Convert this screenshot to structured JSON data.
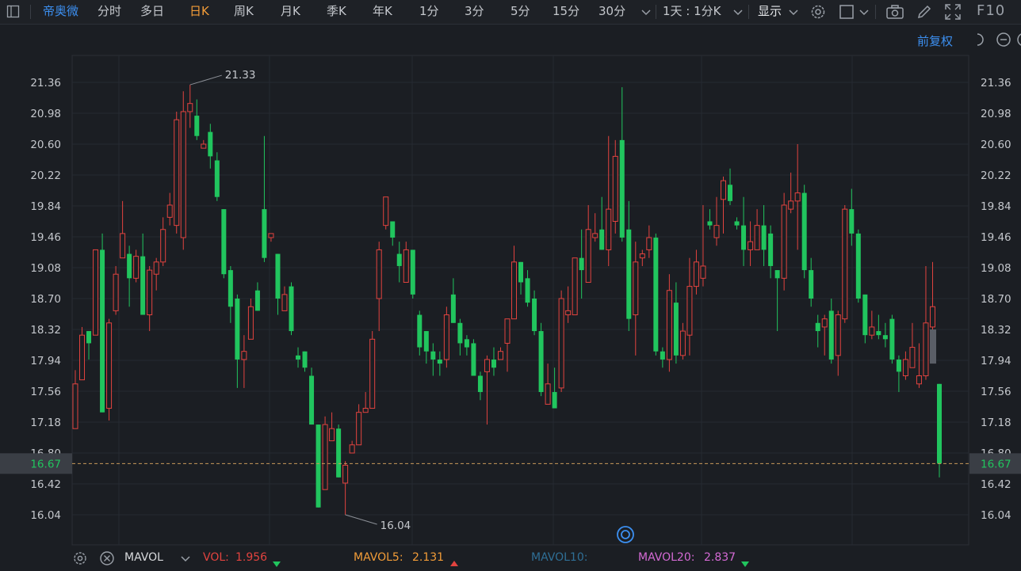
{
  "toolbar": {
    "stock_name": "帝奥微",
    "periods": [
      "分时",
      "多日",
      "日K",
      "周K",
      "月K",
      "季K",
      "年K",
      "1分",
      "3分",
      "5分",
      "15分",
      "30分"
    ],
    "active_period": "日K",
    "interval_select": "1天 : 1分K",
    "display_select": "显示",
    "f10": "F10"
  },
  "adjust_label": "前复权",
  "chart_data": {
    "type": "candlestick",
    "y_ticks": [
      "21.36",
      "20.98",
      "20.60",
      "20.22",
      "19.84",
      "19.46",
      "19.08",
      "18.70",
      "18.32",
      "17.94",
      "17.56",
      "17.18",
      "16.80",
      "16.42",
      "16.04"
    ],
    "current_price": "16.67",
    "high_label": "21.33",
    "low_label": "16.04",
    "up_color": "#e2433f",
    "down_color": "#21c55e",
    "candles": [
      [
        17.1,
        17.65,
        17.82,
        17.1
      ],
      [
        17.7,
        18.25,
        18.35,
        17.7
      ],
      [
        18.3,
        18.15,
        18.3,
        17.95
      ],
      [
        18.25,
        19.3,
        19.3,
        18.25
      ],
      [
        19.3,
        17.3,
        19.5,
        17.3
      ],
      [
        17.35,
        18.4,
        18.45,
        17.2
      ],
      [
        18.55,
        19.0,
        19.1,
        18.5
      ],
      [
        19.2,
        19.5,
        19.9,
        19.2
      ],
      [
        19.25,
        18.95,
        19.35,
        18.6
      ],
      [
        18.95,
        19.22,
        19.3,
        18.9
      ],
      [
        19.22,
        18.5,
        19.5,
        18.5
      ],
      [
        18.5,
        19.05,
        19.1,
        18.3
      ],
      [
        19.0,
        19.15,
        19.2,
        18.8
      ],
      [
        19.15,
        19.55,
        19.7,
        19.1
      ],
      [
        19.7,
        19.85,
        20.0,
        19.6
      ],
      [
        19.6,
        20.9,
        21.0,
        19.5
      ],
      [
        19.45,
        21.0,
        21.25,
        19.3
      ],
      [
        21.0,
        21.1,
        21.33,
        20.8
      ],
      [
        20.95,
        20.7,
        21.15,
        20.65
      ],
      [
        20.55,
        20.6,
        20.65,
        20.55
      ],
      [
        20.75,
        20.45,
        20.85,
        20.3
      ],
      [
        20.4,
        19.95,
        20.5,
        19.9
      ],
      [
        19.8,
        19.0,
        19.8,
        18.95
      ],
      [
        19.05,
        18.6,
        19.1,
        18.4
      ],
      [
        18.7,
        17.95,
        18.75,
        17.6
      ],
      [
        17.95,
        18.05,
        18.25,
        17.6
      ],
      [
        18.2,
        18.6,
        18.7,
        18.2
      ],
      [
        18.8,
        18.55,
        18.9,
        18.55
      ],
      [
        19.8,
        19.2,
        20.7,
        19.15
      ],
      [
        19.45,
        19.5,
        19.5,
        19.4
      ],
      [
        19.25,
        18.7,
        19.25,
        18.5
      ],
      [
        18.55,
        18.75,
        18.85,
        18.55
      ],
      [
        18.85,
        18.3,
        18.9,
        18.25
      ],
      [
        18.0,
        17.95,
        18.1,
        17.85
      ],
      [
        18.05,
        17.85,
        18.05,
        17.8
      ],
      [
        17.75,
        17.15,
        17.85,
        17.15
      ],
      [
        17.15,
        16.13,
        17.15,
        16.13
      ],
      [
        16.35,
        17.15,
        17.25,
        16.35
      ],
      [
        16.95,
        17.1,
        17.3,
        16.95
      ],
      [
        17.1,
        16.5,
        17.15,
        16.5
      ],
      [
        16.43,
        16.65,
        16.7,
        16.04
      ],
      [
        16.8,
        16.9,
        16.95,
        16.8
      ],
      [
        16.9,
        17.3,
        17.4,
        16.9
      ],
      [
        17.3,
        17.35,
        17.55,
        17.3
      ],
      [
        17.35,
        18.2,
        18.3,
        17.35
      ],
      [
        18.7,
        19.3,
        19.4,
        18.3
      ],
      [
        19.6,
        19.95,
        19.95,
        19.55
      ],
      [
        19.65,
        19.45,
        19.65,
        19.35
      ],
      [
        19.25,
        19.1,
        19.4,
        18.9
      ],
      [
        18.9,
        19.3,
        19.4,
        18.9
      ],
      [
        19.3,
        18.75,
        19.3,
        18.7
      ],
      [
        18.5,
        18.1,
        18.55,
        18.0
      ],
      [
        18.3,
        18.05,
        18.3,
        17.9
      ],
      [
        18.05,
        17.95,
        18.15,
        17.75
      ],
      [
        17.95,
        17.9,
        18.05,
        17.75
      ],
      [
        17.95,
        18.5,
        18.6,
        17.85
      ],
      [
        18.75,
        18.4,
        18.95,
        18.4
      ],
      [
        18.4,
        18.15,
        18.45,
        18.0
      ],
      [
        18.2,
        18.1,
        18.25,
        18.0
      ],
      [
        18.15,
        17.75,
        18.2,
        17.75
      ],
      [
        17.75,
        17.55,
        17.8,
        17.45
      ],
      [
        17.8,
        17.95,
        18.0,
        17.15
      ],
      [
        17.95,
        17.85,
        18.1,
        17.75
      ],
      [
        17.95,
        18.05,
        18.1,
        17.95
      ],
      [
        18.15,
        18.45,
        18.45,
        17.8
      ],
      [
        18.45,
        19.15,
        19.35,
        18.45
      ],
      [
        19.15,
        18.9,
        19.15,
        18.75
      ],
      [
        18.95,
        18.65,
        19.05,
        18.6
      ],
      [
        18.7,
        18.3,
        18.8,
        18.25
      ],
      [
        18.3,
        17.55,
        18.4,
        17.5
      ],
      [
        17.4,
        17.65,
        17.9,
        17.4
      ],
      [
        17.55,
        17.35,
        17.85,
        17.35
      ],
      [
        17.6,
        18.7,
        18.8,
        17.55
      ],
      [
        18.5,
        18.55,
        18.85,
        18.4
      ],
      [
        18.5,
        19.2,
        19.2,
        18.5
      ],
      [
        19.2,
        19.05,
        19.55,
        18.7
      ],
      [
        18.9,
        19.55,
        19.85,
        18.9
      ],
      [
        19.45,
        19.5,
        19.75,
        19.4
      ],
      [
        19.55,
        19.3,
        19.95,
        19.3
      ],
      [
        19.3,
        19.8,
        20.7,
        19.1
      ],
      [
        19.65,
        20.45,
        20.65,
        19.5
      ],
      [
        20.65,
        19.45,
        21.3,
        19.4
      ],
      [
        19.55,
        18.45,
        19.9,
        18.3
      ],
      [
        18.5,
        19.15,
        19.4,
        18.0
      ],
      [
        19.2,
        19.25,
        19.3,
        19.1
      ],
      [
        19.3,
        19.45,
        19.6,
        19.2
      ],
      [
        19.45,
        18.05,
        19.5,
        18.0
      ],
      [
        18.05,
        17.95,
        18.1,
        17.85
      ],
      [
        17.95,
        18.8,
        19.0,
        17.8
      ],
      [
        18.65,
        18.0,
        18.9,
        17.9
      ],
      [
        18.0,
        18.3,
        18.4,
        17.95
      ],
      [
        18.25,
        18.85,
        19.2,
        18.0
      ],
      [
        18.85,
        19.15,
        19.3,
        18.75
      ],
      [
        18.95,
        19.1,
        19.85,
        18.85
      ],
      [
        19.65,
        19.6,
        19.8,
        19.55
      ],
      [
        19.45,
        19.6,
        19.95,
        19.35
      ],
      [
        19.92,
        20.15,
        20.2,
        19.5
      ],
      [
        20.1,
        19.9,
        20.3,
        19.85
      ],
      [
        19.65,
        19.6,
        19.7,
        19.55
      ],
      [
        19.6,
        19.3,
        19.95,
        19.1
      ],
      [
        19.3,
        19.4,
        19.65,
        19.1
      ],
      [
        19.3,
        19.6,
        19.8,
        19.3
      ],
      [
        19.6,
        19.3,
        19.85,
        19.1
      ],
      [
        19.5,
        19.1,
        19.6,
        18.95
      ],
      [
        19.05,
        18.95,
        19.05,
        18.3
      ],
      [
        18.95,
        19.85,
        20.0,
        18.8
      ],
      [
        19.8,
        19.9,
        20.25,
        19.75
      ],
      [
        19.9,
        20.0,
        20.6,
        19.3
      ],
      [
        20.0,
        19.05,
        20.1,
        18.95
      ],
      [
        19.05,
        18.7,
        19.2,
        18.6
      ],
      [
        18.4,
        18.3,
        18.5,
        18.1
      ],
      [
        18.35,
        18.45,
        18.5,
        18.0
      ],
      [
        18.55,
        17.95,
        18.7,
        17.9
      ],
      [
        18.0,
        18.5,
        18.55,
        17.75
      ],
      [
        18.45,
        19.8,
        19.85,
        18.4
      ],
      [
        19.8,
        19.5,
        20.05,
        19.35
      ],
      [
        19.5,
        18.7,
        19.55,
        18.65
      ],
      [
        18.75,
        18.25,
        18.75,
        18.15
      ],
      [
        18.25,
        18.35,
        18.55,
        18.2
      ],
      [
        18.3,
        18.25,
        18.5,
        18.2
      ],
      [
        18.25,
        18.2,
        18.4,
        18.1
      ],
      [
        18.45,
        17.95,
        18.5,
        17.9
      ],
      [
        17.95,
        17.8,
        18.0,
        17.55
      ],
      [
        17.75,
        17.95,
        18.05,
        17.7
      ],
      [
        17.85,
        18.1,
        18.4,
        17.85
      ],
      [
        17.65,
        17.75,
        18.15,
        17.6
      ],
      [
        17.75,
        18.4,
        19.1,
        17.7
      ],
      [
        18.35,
        18.6,
        19.15,
        18.3
      ],
      [
        17.65,
        16.67,
        17.65,
        16.5
      ]
    ],
    "last_candle_volume_marker_y": [
      18.32,
      17.9
    ]
  },
  "indicator": {
    "name": "MAVOL",
    "vol_label": "VOL:",
    "vol_value": "1.956",
    "mavol5_label": "MAVOL5:",
    "mavol5_value": "2.131",
    "mavol10_label": "MAVOL10:",
    "mavol20_label": "MAVOL20:",
    "mavol20_value": "2.837"
  }
}
